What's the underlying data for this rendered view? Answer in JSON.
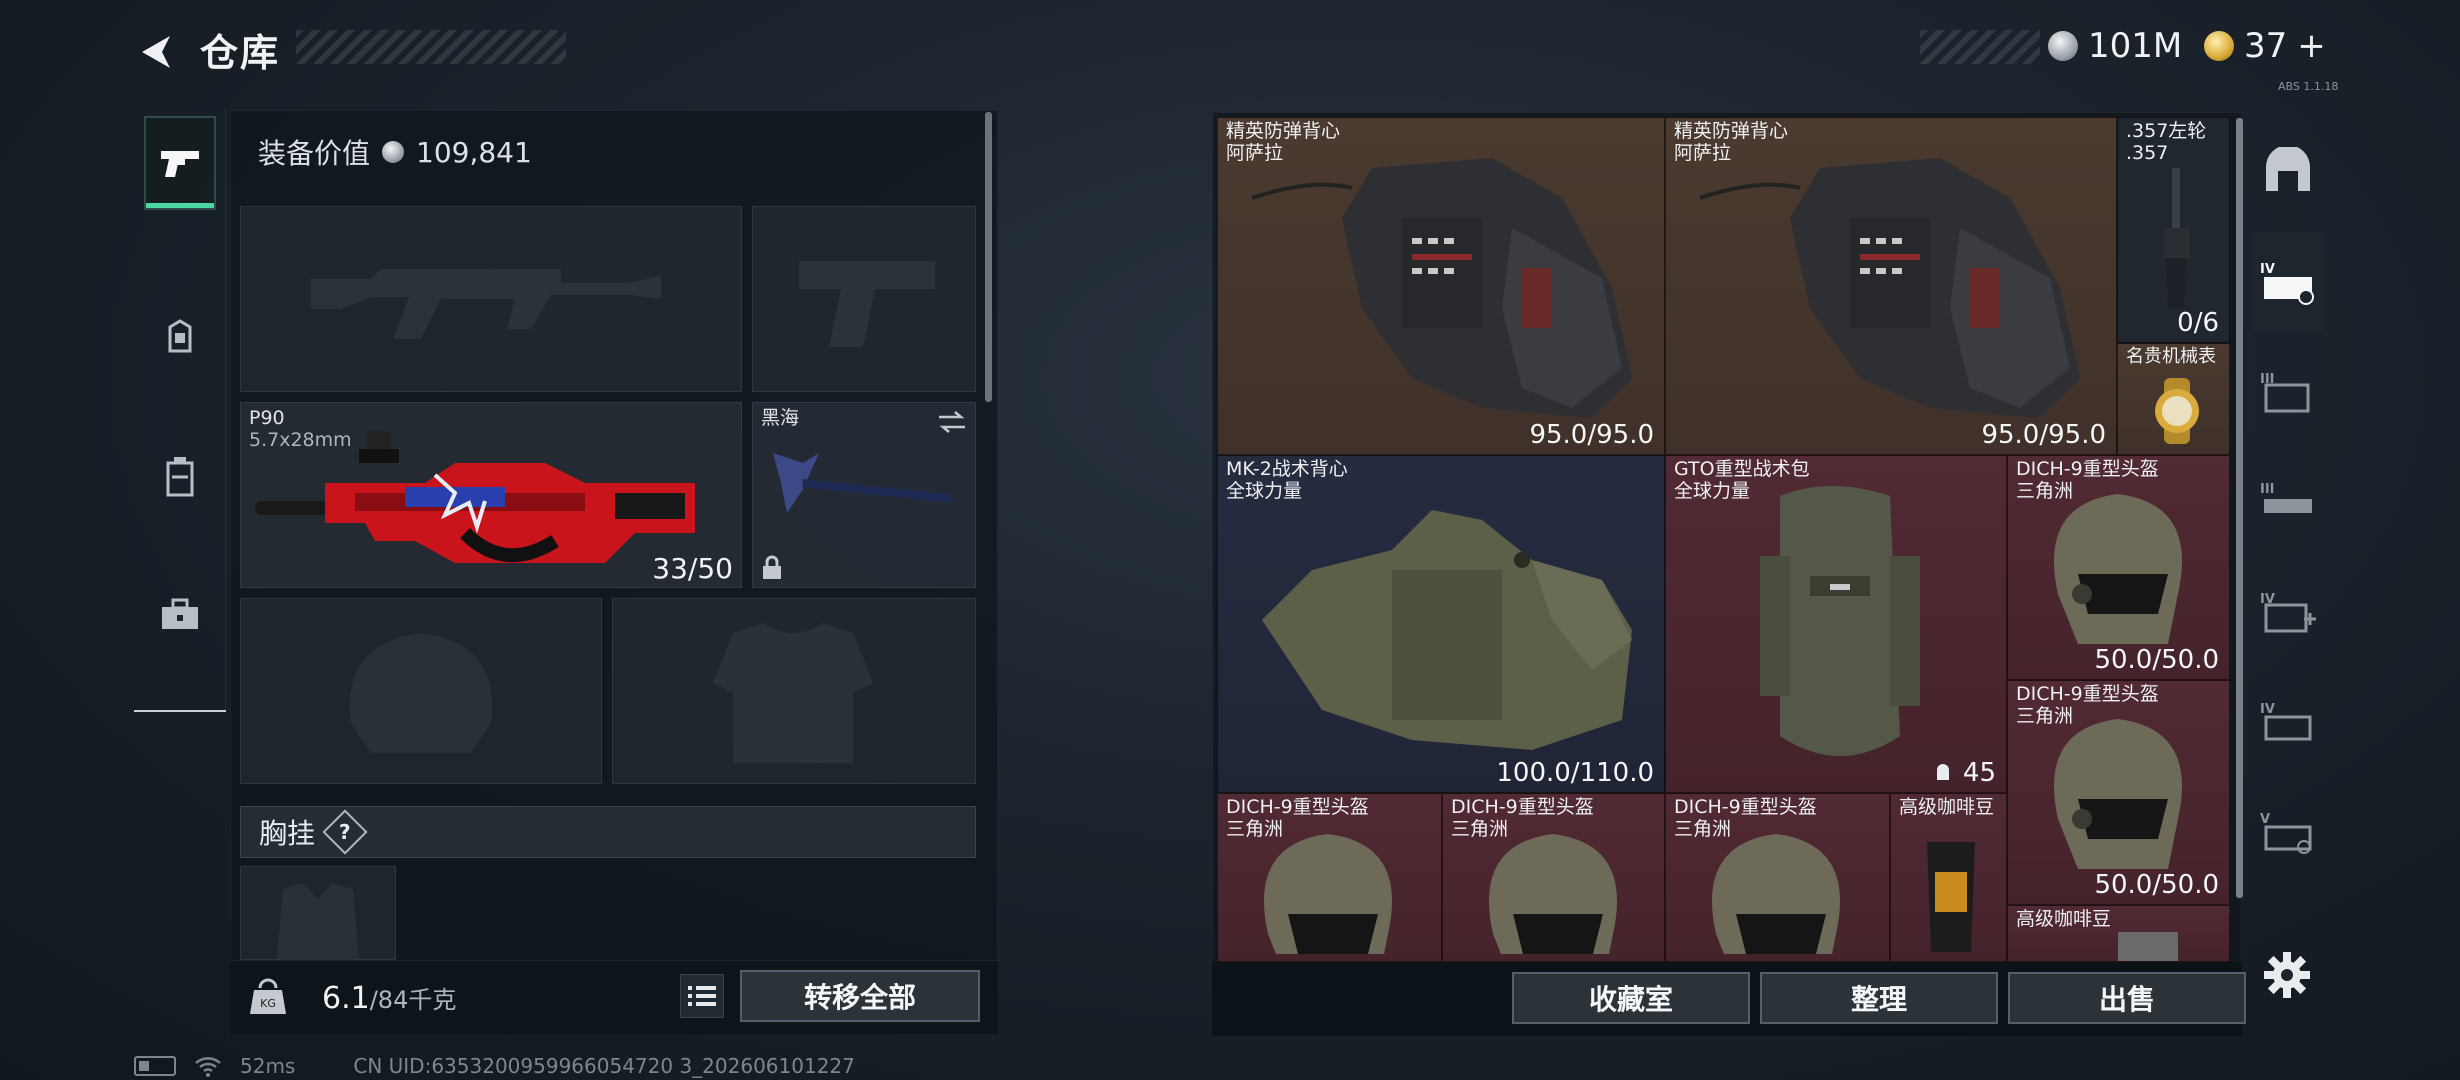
{
  "header": {
    "title": "仓库",
    "currency": [
      {
        "icon": "silver-coin-icon",
        "value": "101M"
      },
      {
        "icon": "gold-coin-icon",
        "value": "37",
        "suffix": "+"
      }
    ],
    "tiny_code": "ABS 1.1.18"
  },
  "left_tabs": [
    {
      "name": "weapons-tab",
      "icon": "pistol-icon",
      "active": true
    },
    {
      "name": "gear-tab",
      "icon": "backpack-icon",
      "active": false
    },
    {
      "name": "consumables-tab",
      "icon": "container-icon",
      "active": false
    },
    {
      "name": "tools-tab",
      "icon": "toolbox-icon",
      "active": false
    }
  ],
  "loadout": {
    "equip_value_label": "装备价值",
    "equip_value": "109,841",
    "primary_weapon": {
      "name": "P90",
      "caliber": "5.7x28mm",
      "ammo": "33/50"
    },
    "melee": {
      "name": "黑海"
    },
    "chest_rig_label": "胸挂",
    "help": "?",
    "weight_value": "6.1",
    "weight_limit": "/84千克",
    "transfer_all": "转移全部"
  },
  "stash_items": [
    {
      "name": "精英防弹背心",
      "sub": "阿萨拉",
      "value": "95.0/95.0"
    },
    {
      "name": "精英防弹背心",
      "sub": "阿萨拉",
      "value": "95.0/95.0"
    },
    {
      "name": ".357左轮",
      "sub": ".357",
      "value": "0/6"
    },
    {
      "name": "名贵机械表",
      "sub": "",
      "value": ""
    },
    {
      "name": "MK-2战术背心",
      "sub": "全球力量",
      "value": "100.0/110.0"
    },
    {
      "name": "GTO重型战术包",
      "sub": "全球力量",
      "value": "45"
    },
    {
      "name": "DICH-9重型头盔",
      "sub": "三角洲",
      "value": "50.0/50.0"
    },
    {
      "name": "DICH-9重型头盔",
      "sub": "三角洲",
      "value": "50.0/50.0"
    },
    {
      "name": "DICH-9重型头盔",
      "sub": "三角洲",
      "value": ""
    },
    {
      "name": "DICH-9重型头盔",
      "sub": "三角洲",
      "value": ""
    },
    {
      "name": "DICH-9重型头盔",
      "sub": "三角洲",
      "value": ""
    },
    {
      "name": "高级咖啡豆",
      "sub": "",
      "value": ""
    },
    {
      "name": "高级咖啡豆",
      "sub": "",
      "value": ""
    }
  ],
  "stash_actions": {
    "collection": "收藏室",
    "organize": "整理",
    "sell": "出售"
  },
  "filter_tabs": [
    "all-icon",
    "level-iv-armor-icon",
    "level-iii-armor-icon",
    "level-iii-rig-icon",
    "level-iv-medkit-icon",
    "level-iv-pack-icon",
    "level-v-pack-icon"
  ],
  "status": {
    "ping": "52ms",
    "uid": "CN UID:6353200959966054720 3_202606101227"
  },
  "colors": {
    "rarity_red": "#512a33",
    "rarity_brown": "#4a3a30",
    "rarity_navy": "#262c40",
    "accent": "#4dd7a4"
  }
}
